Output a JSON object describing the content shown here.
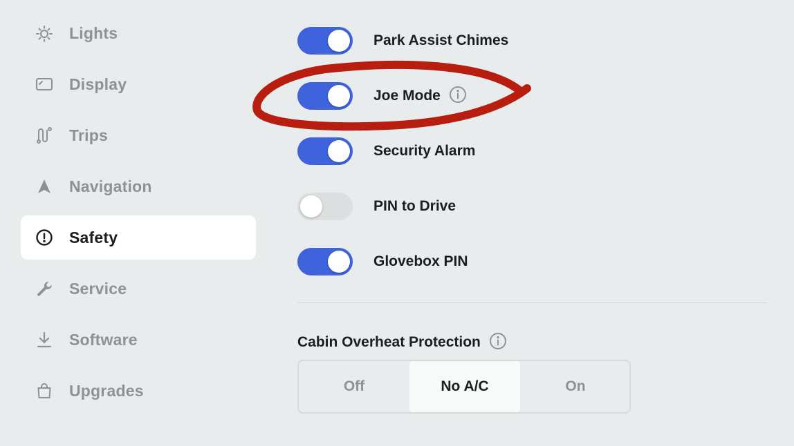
{
  "colors": {
    "background": "#e8ecec",
    "toggle_on": "#3e63dd",
    "toggle_off": "#dcdfe0",
    "annotation_red": "#b81e0f",
    "active_nav_bg": "#ffffff"
  },
  "sidebar": {
    "items": [
      {
        "label": "Lights",
        "icon": "sun-icon",
        "active": false
      },
      {
        "label": "Display",
        "icon": "display-icon",
        "active": false
      },
      {
        "label": "Trips",
        "icon": "route-icon",
        "active": false
      },
      {
        "label": "Navigation",
        "icon": "navigation-arrow-icon",
        "active": false
      },
      {
        "label": "Safety",
        "icon": "alert-circle-icon",
        "active": true
      },
      {
        "label": "Service",
        "icon": "wrench-icon",
        "active": false
      },
      {
        "label": "Software",
        "icon": "download-icon",
        "active": false
      },
      {
        "label": "Upgrades",
        "icon": "shopping-bag-icon",
        "active": false
      }
    ]
  },
  "toggles": [
    {
      "label": "Park Assist Chimes",
      "on": true,
      "info": false
    },
    {
      "label": "Joe Mode",
      "on": true,
      "info": true
    },
    {
      "label": "Security Alarm",
      "on": true,
      "info": false
    },
    {
      "label": "PIN to Drive",
      "on": false,
      "info": false
    },
    {
      "label": "Glovebox PIN",
      "on": true,
      "info": false
    }
  ],
  "cabin_overheat": {
    "title": "Cabin Overheat Protection",
    "info": true,
    "options": [
      "Off",
      "No A/C",
      "On"
    ],
    "selected": "No A/C"
  }
}
